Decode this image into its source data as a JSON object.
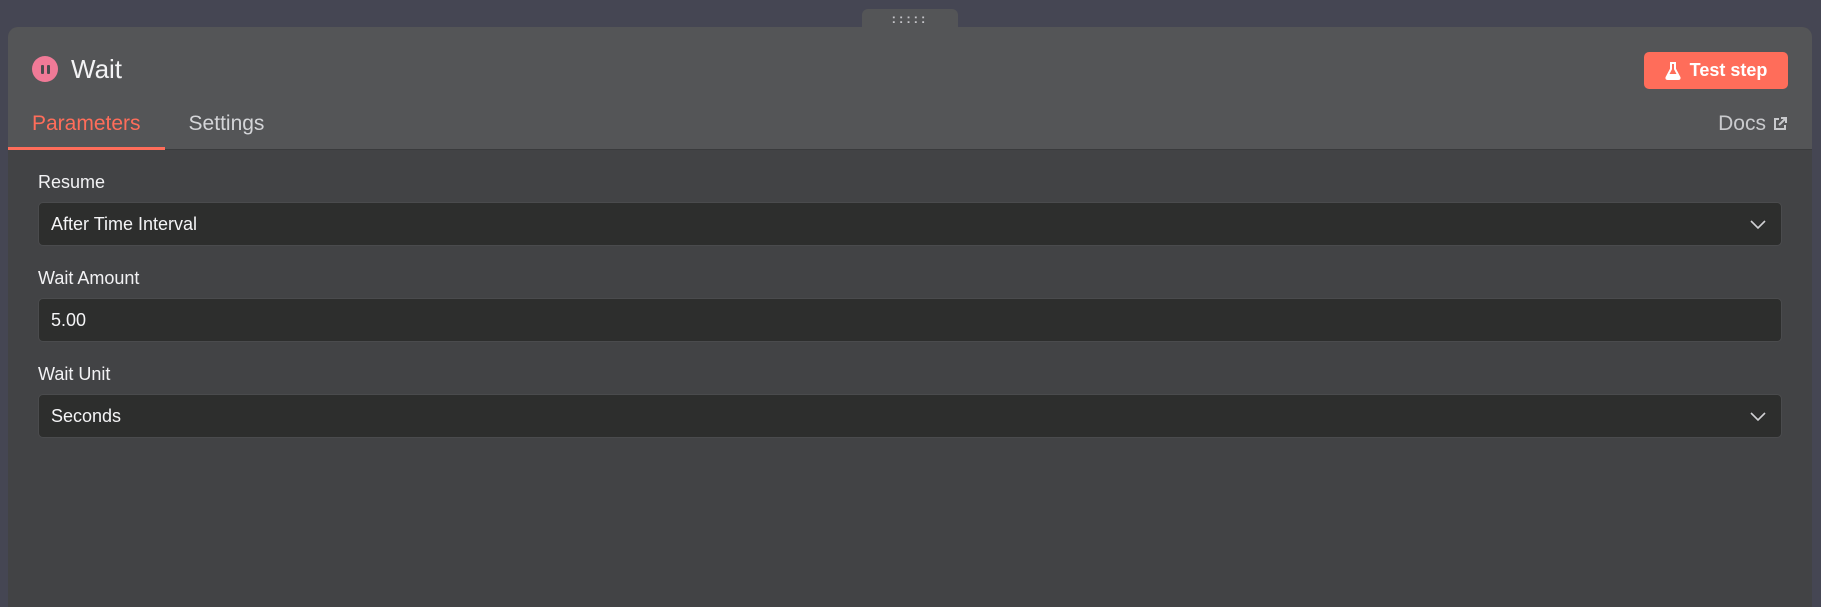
{
  "handle": {
    "glyph": ":::::"
  },
  "node": {
    "title": "Wait",
    "icon": "pause-icon",
    "icon_color": "#f07a97"
  },
  "toolbar": {
    "test_step_label": "Test step",
    "test_step_icon": "flask-icon",
    "accent": "#ff6d5a"
  },
  "tabs": [
    {
      "label": "Parameters",
      "active": true
    },
    {
      "label": "Settings",
      "active": false
    }
  ],
  "docs": {
    "label": "Docs",
    "icon": "external-link-icon"
  },
  "fields": {
    "resume": {
      "label": "Resume",
      "value": "After Time Interval"
    },
    "wait_amount": {
      "label": "Wait Amount",
      "value": "5.00"
    },
    "wait_unit": {
      "label": "Wait Unit",
      "value": "Seconds"
    }
  }
}
